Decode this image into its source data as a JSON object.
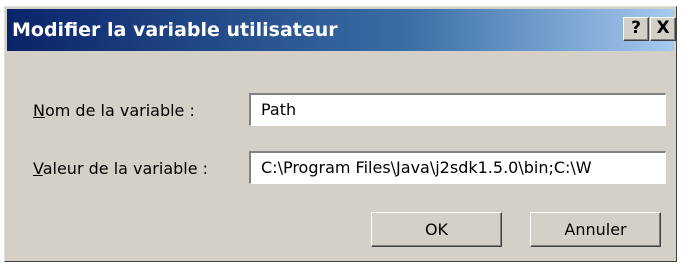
{
  "window": {
    "title": "Modifier la variable utilisateur",
    "help_label": "?",
    "close_label": "X"
  },
  "form": {
    "name_label_accel": "N",
    "name_label_rest": "om de la variable :",
    "name_value": "Path",
    "value_label_accel": "V",
    "value_label_rest": "aleur de la variable :",
    "value_value": "C:\\Program Files\\Java\\j2sdk1.5.0\\bin;C:\\W"
  },
  "buttons": {
    "ok_label": "OK",
    "cancel_label": "Annuler"
  }
}
